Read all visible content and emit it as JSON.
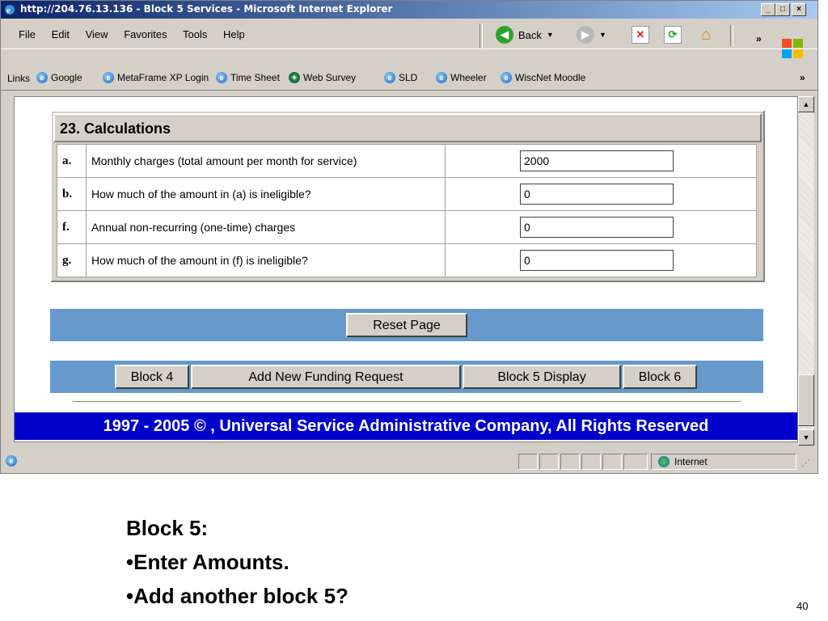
{
  "window": {
    "title": "http://204.76.13.136 - Block 5 Services - Microsoft Internet Explorer",
    "minimize": "_",
    "maximize": "□",
    "close": "×"
  },
  "menu": {
    "items": [
      "File",
      "Edit",
      "View",
      "Favorites",
      "Tools",
      "Help"
    ],
    "back_label": "Back",
    "more": "»"
  },
  "links": {
    "label": "Links",
    "items": [
      "Google",
      "MetaFrame XP Login",
      "Time Sheet",
      "Web Survey",
      "SLD",
      "Wheeler",
      "WiscNet Moodle"
    ],
    "more": "»"
  },
  "calc": {
    "heading": "23. Calculations",
    "rows": [
      {
        "letter": "a.",
        "desc": "Monthly charges (total amount per month for service)",
        "value": "2000"
      },
      {
        "letter": "b.",
        "desc": "How much of the amount in (a) is ineligible?",
        "value": "0"
      },
      {
        "letter": "f.",
        "desc": "Annual non-recurring (one-time) charges",
        "value": "0"
      },
      {
        "letter": "g.",
        "desc": "How much of the amount in (f) is ineligible?",
        "value": "0"
      }
    ]
  },
  "buttons": {
    "reset": "Reset Page",
    "block4": "Block 4",
    "add": "Add New Funding Request",
    "display": "Block 5 Display",
    "block6": "Block 6"
  },
  "footer": "1997 - 2005 © , Universal Service Administrative Company, All Rights Reserved",
  "status": {
    "zone": "Internet"
  },
  "slide": {
    "line1": "Block  5:",
    "line2": "•Enter Amounts.",
    "line3": "•Add another block 5?",
    "page": "40"
  },
  "colors": {
    "titlebar": "#0a246a",
    "bar": "#6699cc",
    "footer": "#0000cc"
  }
}
